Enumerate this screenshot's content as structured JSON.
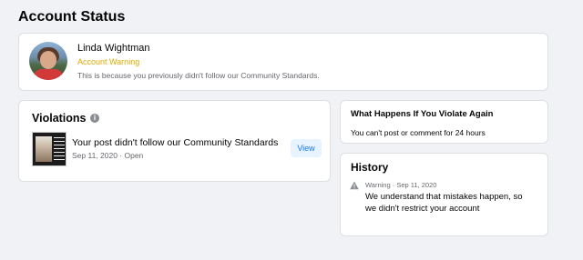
{
  "page": {
    "title": "Account Status"
  },
  "account": {
    "name": "Linda Wightman",
    "status": "Account Warning",
    "description": "This is because you previously didn't follow our Community Standards."
  },
  "violations": {
    "title": "Violations",
    "items": [
      {
        "title": "Your post didn't follow our Community Standards",
        "meta": "Sep 11, 2020 · Open",
        "action_label": "View"
      }
    ]
  },
  "consequences": {
    "title": "What Happens If You Violate Again",
    "text": "You can't post or comment for 24 hours"
  },
  "history": {
    "title": "History",
    "items": [
      {
        "meta": "Warning · Sep 11, 2020",
        "line1": "We understand that mistakes happen, so",
        "line2": "we didn't restrict your account"
      }
    ]
  },
  "colors": {
    "background": "#f0f2f5",
    "warning": "#e0a800",
    "link": "#1877f2",
    "secondary_text": "#65676b"
  },
  "icons": {
    "info": "info-icon",
    "history_warning": "warning-triangle-icon"
  }
}
